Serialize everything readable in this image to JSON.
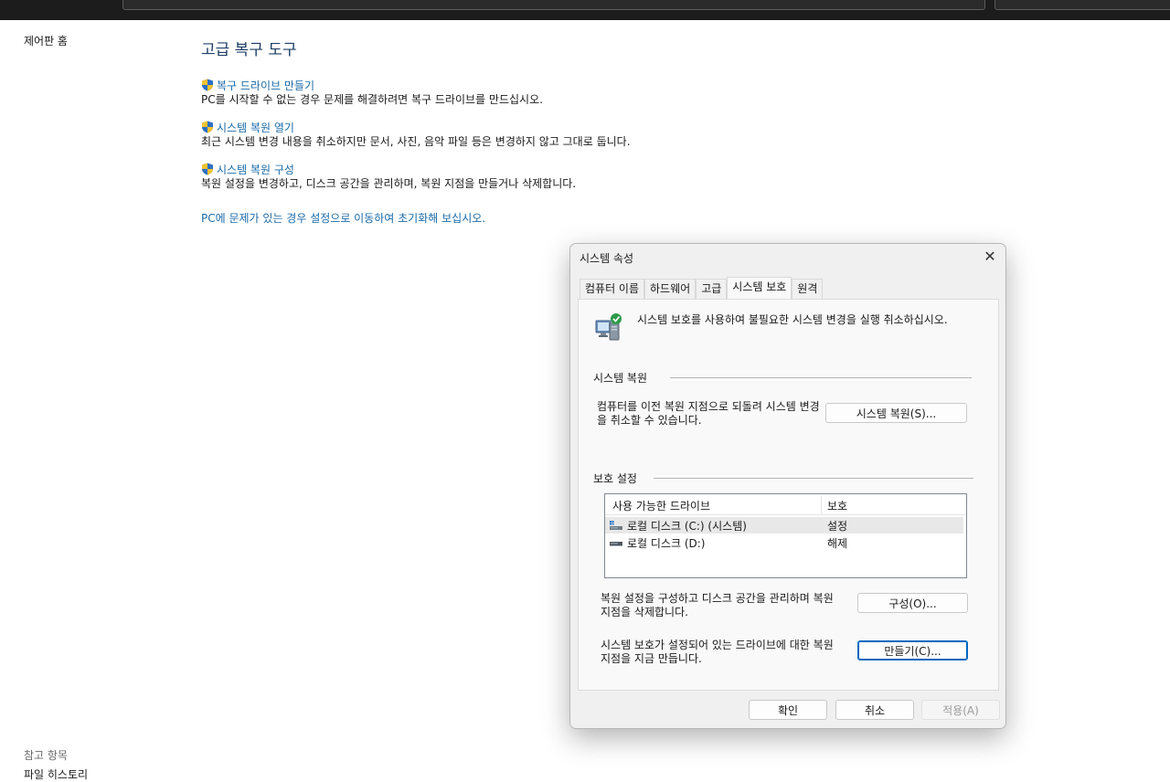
{
  "sidebar": {
    "home_label": "제어판 홈",
    "see_also_label": "참고 항목",
    "see_also_items": [
      "파일 히스토리"
    ]
  },
  "main": {
    "title": "고급 복구 도구",
    "tools": [
      {
        "link": "복구 드라이브 만들기",
        "desc": "PC를 시작할 수 없는 경우 문제를 해결하려면 복구 드라이브를 만드십시오."
      },
      {
        "link": "시스템 복원 열기",
        "desc": "최근 시스템 변경 내용을 취소하지만 문서, 사진, 음악 파일 등은 변경하지 않고 그대로 둡니다."
      },
      {
        "link": "시스템 복원 구성",
        "desc": "복원 설정을 변경하고, 디스크 공간을 관리하며, 복원 지점을 만들거나 삭제합니다."
      }
    ],
    "reset_link": "PC에 문제가 있는 경우 설정으로 이동하여 초기화해 보십시오."
  },
  "dialog": {
    "title": "시스템 속성",
    "close_glyph": "✕",
    "tabs": [
      "컴퓨터 이름",
      "하드웨어",
      "고급",
      "시스템 보호",
      "원격"
    ],
    "active_tab": "시스템 보호",
    "intro": "시스템 보호를 사용하여 불필요한 시스템 변경을 실행 취소하십시오.",
    "restore_section": {
      "label": "시스템 복원",
      "desc": "컴퓨터를 이전 복원 지점으로 되돌려 시스템 변경을 취소할 수 있습니다.",
      "button": "시스템 복원(S)..."
    },
    "protection_section": {
      "label": "보호 설정",
      "columns": [
        "사용 가능한 드라이브",
        "보호"
      ],
      "drives": [
        {
          "name": "로컬 디스크 (C:) (시스템)",
          "state": "설정",
          "icon": "system-drive-icon"
        },
        {
          "name": "로컬 디스크 (D:)",
          "state": "해제",
          "icon": "drive-icon"
        }
      ],
      "configure_desc": "복원 설정을 구성하고 디스크 공간을 관리하며 복원 지점을 삭제합니다.",
      "configure_button": "구성(O)...",
      "create_desc": "시스템 보호가 설정되어 있는 드라이브에 대한 복원 지점을 지금 만듭니다.",
      "create_button": "만들기(C)..."
    },
    "footer": {
      "ok": "확인",
      "cancel": "취소",
      "apply": "적용(A)"
    }
  },
  "colors": {
    "link": "#1a6aa8",
    "title": "#1e3f66",
    "focus": "#0067c0",
    "topbar": "#1c1c1c"
  }
}
